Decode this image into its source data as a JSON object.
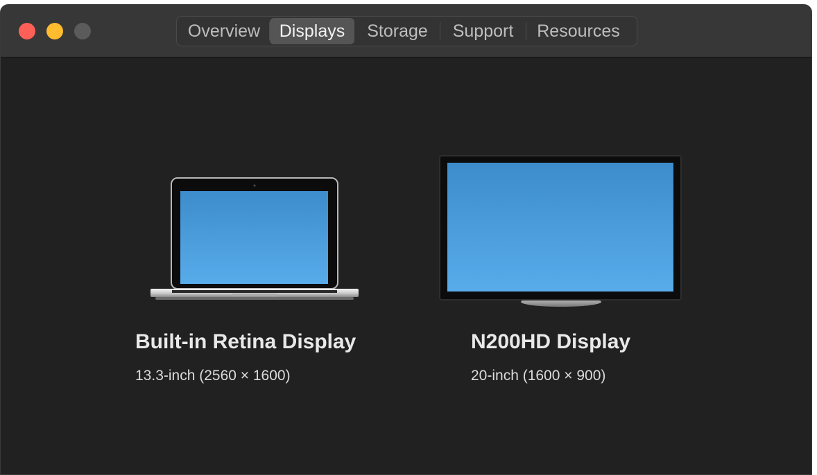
{
  "window": {
    "traffic_lights": [
      "close",
      "minimize",
      "zoom"
    ]
  },
  "tabs": [
    {
      "label": "Overview",
      "active": false
    },
    {
      "label": "Displays",
      "active": true
    },
    {
      "label": "Storage",
      "active": false
    },
    {
      "label": "Support",
      "active": false
    },
    {
      "label": "Resources",
      "active": false
    }
  ],
  "displays": [
    {
      "name": "Built-in Retina Display",
      "spec": "13.3-inch (2560 × 1600)",
      "icon": "laptop-icon"
    },
    {
      "name": "N200HD Display",
      "spec": "20-inch (1600 × 900)",
      "icon": "monitor-icon"
    }
  ],
  "colors": {
    "background": "#212121",
    "titlebar": "#373737",
    "close": "#fe5f57",
    "minimize": "#febc2e",
    "zoom_disabled": "#5b5b5b",
    "screen_blue": "#4a9ad8"
  }
}
